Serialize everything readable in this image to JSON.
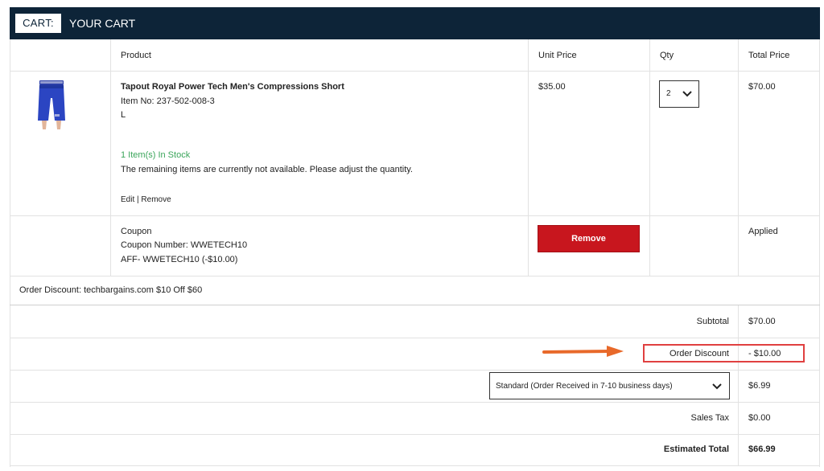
{
  "header": {
    "tag": "CART:",
    "title": "YOUR CART"
  },
  "columns": {
    "product": "Product",
    "unit_price": "Unit Price",
    "qty": "Qty",
    "total_price": "Total Price"
  },
  "item": {
    "name": "Tapout Royal Power Tech Men's Compressions Short",
    "item_no": "Item No: 237-502-008-3",
    "size": "L",
    "stock": "1 Item(s) In Stock",
    "notice": "The remaining items are currently not available. Please adjust the quantity.",
    "edit_label": "Edit",
    "separator": "|",
    "remove_label": "Remove",
    "unit_price": "$35.00",
    "qty": "2",
    "total_price": "$70.00"
  },
  "coupon": {
    "label": "Coupon",
    "number": "Coupon Number: WWETECH10",
    "detail": "AFF- WWETECH10 (-$10.00)",
    "remove_button": "Remove",
    "status": "Applied"
  },
  "order_discount_note": "Order Discount: techbargains.com $10 Off $60",
  "summary": {
    "subtotal_label": "Subtotal",
    "subtotal_value": "$70.00",
    "discount_label": "Order Discount",
    "discount_value": "- $10.00",
    "shipping_option": "Standard (Order Received in 7-10 business days)",
    "shipping_value": "$6.99",
    "tax_label": "Sales Tax",
    "tax_value": "$0.00",
    "total_label": "Estimated Total",
    "total_value": "$66.99"
  },
  "colors": {
    "header_bg": "#0d2438",
    "remove_button": "#c8161e",
    "stock_text": "#3aa55a",
    "highlight_box": "#e04040",
    "arrow": "#e8692a"
  }
}
